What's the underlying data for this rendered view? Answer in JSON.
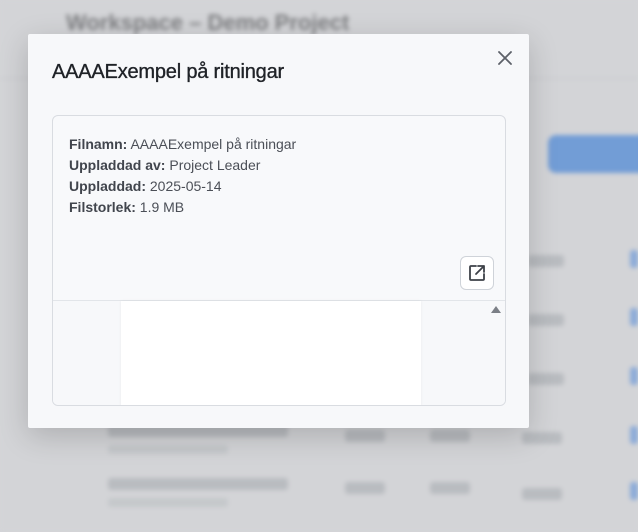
{
  "background": {
    "title": "Workspace – Demo Project"
  },
  "modal": {
    "title": "AAAAExempel på ritningar",
    "close_icon": "close-icon",
    "file_info": {
      "filename_label": "Filnamn:",
      "filename_value": "AAAAExempel på ritningar",
      "uploaded_by_label": "Uppladdad av:",
      "uploaded_by_value": "Project Leader",
      "uploaded_label": "Uppladdad:",
      "uploaded_value": "2025-05-14",
      "size_label": "Filstorlek:",
      "size_value": "1.9 MB"
    },
    "open_external_icon": "open-external-icon",
    "scroll_up_icon": "scroll-up-arrow-icon"
  },
  "colors": {
    "accent": "#5a8fd6",
    "modal_bg": "#f7f8fa"
  }
}
